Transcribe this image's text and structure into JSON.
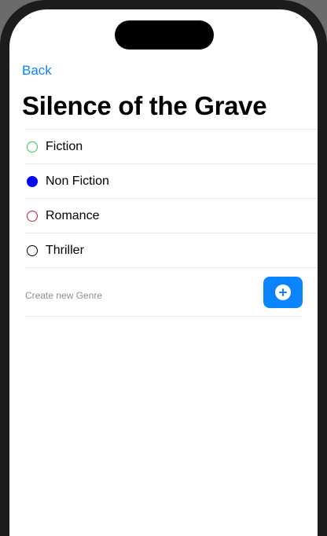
{
  "nav": {
    "back_label": "Back"
  },
  "book": {
    "title": "Silence of the Grave"
  },
  "genres": [
    {
      "label": "Fiction",
      "color": "#34c759",
      "filled": false
    },
    {
      "label": "Non Fiction",
      "color": "#0000ff",
      "filled": true
    },
    {
      "label": "Romance",
      "color": "#c41e3a",
      "filled": false
    },
    {
      "label": "Thriller",
      "color": "#000000",
      "filled": false
    }
  ],
  "create": {
    "placeholder": "Create new Genre",
    "value": "",
    "button_icon": "plus-circle-icon",
    "accent": "#0a84ff"
  }
}
